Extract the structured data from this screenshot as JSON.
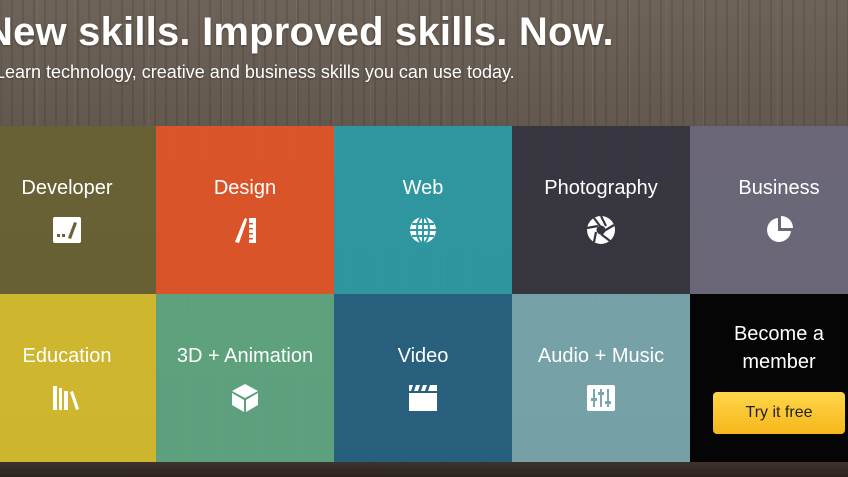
{
  "hero": {
    "title": "New skills. Improved skills. Now.",
    "subtitle": "Learn technology, creative and business skills you can use today."
  },
  "categories": [
    {
      "label": "Developer",
      "icon": "developer-icon",
      "color": "#686234"
    },
    {
      "label": "Design",
      "icon": "design-tools-icon",
      "color": "#de5528"
    },
    {
      "label": "Web",
      "icon": "globe-icon",
      "color": "#2c9ba6"
    },
    {
      "label": "Photography",
      "icon": "aperture-icon",
      "color": "#36353f"
    },
    {
      "label": "Business",
      "icon": "pie-chart-icon",
      "color": "#6c687c"
    },
    {
      "label": "Education",
      "icon": "books-icon",
      "color": "#d7be2d"
    },
    {
      "label": "3D + Animation",
      "icon": "cube-icon",
      "color": "#5fa882"
    },
    {
      "label": "Video",
      "icon": "clapperboard-icon",
      "color": "#266180"
    },
    {
      "label": "Audio + Music",
      "icon": "mixer-sliders-icon",
      "color": "#78a8ae"
    }
  ],
  "membership": {
    "text": "Become a member",
    "button_label": "Try it free",
    "button_color": "#f6b71a"
  }
}
